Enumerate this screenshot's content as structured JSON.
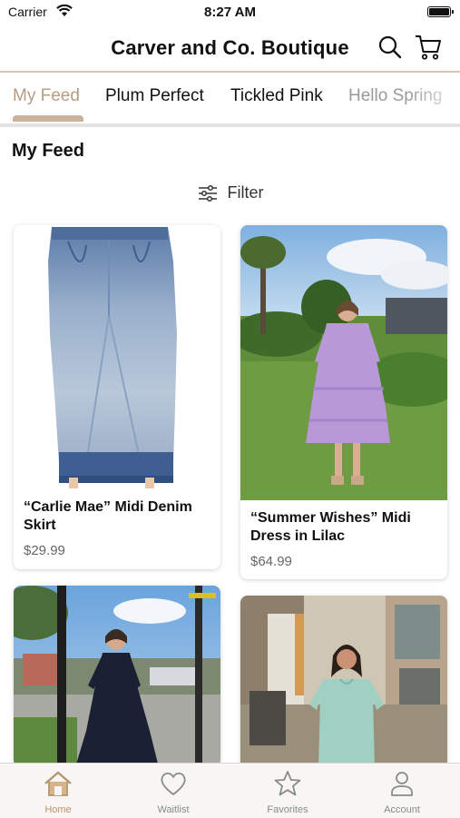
{
  "status_bar": {
    "carrier": "Carrier",
    "time": "8:27 AM"
  },
  "header": {
    "title": "Carver and Co. Boutique",
    "icons": [
      "search-icon",
      "cart-icon"
    ]
  },
  "tabs": [
    {
      "label": "My Feed",
      "active": true
    },
    {
      "label": "Plum Perfect",
      "active": false
    },
    {
      "label": "Tickled Pink",
      "active": false
    },
    {
      "label": "Hello Spring",
      "active": false
    }
  ],
  "feed": {
    "title": "My Feed",
    "filter_label": "Filter"
  },
  "products": [
    {
      "name": "“Carlie Mae” Midi Denim Skirt",
      "price": "$29.99"
    },
    {
      "name": "“Summer Wishes” Midi Dress in Lilac",
      "price": "$64.99"
    },
    {
      "name": "",
      "price": ""
    },
    {
      "name": "",
      "price": ""
    }
  ],
  "tab_bar": {
    "items": [
      {
        "label": "Home",
        "icon": "home-icon",
        "active": true
      },
      {
        "label": "Waitlist",
        "icon": "heart-icon",
        "active": false
      },
      {
        "label": "Favorites",
        "icon": "star-icon",
        "active": false
      },
      {
        "label": "Account",
        "icon": "person-icon",
        "active": false
      }
    ]
  },
  "colors": {
    "accent": "#b8946d",
    "tab_active": "#b59c82",
    "divider": "#d8c7b0"
  }
}
